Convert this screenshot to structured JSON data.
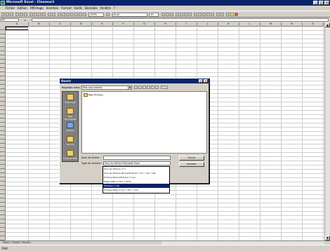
{
  "window": {
    "title": "Microsoft Excel - Classeur1",
    "controls": [
      "_",
      "□",
      "×"
    ]
  },
  "menu": [
    "Fichier",
    "Edition",
    "Affichage",
    "Insertion",
    "Format",
    "Outils",
    "Données",
    "Fenêtre",
    "?"
  ],
  "toolbar": {
    "zoom": "100%",
    "font": "Arial",
    "size": "10"
  },
  "formula_bar": {
    "name_box": "A1",
    "fx": "="
  },
  "columns": [
    "A",
    "B",
    "C",
    "D",
    "E",
    "F",
    "G",
    "H",
    "I",
    "J",
    "K",
    "L",
    "M",
    "N",
    "O"
  ],
  "sheet_tabs": "Feuil1 / Feuil2 / Feuil3 /",
  "status": "Prêt",
  "dialog": {
    "title": "Ouvrir",
    "look_in_label": "Regarder dans :",
    "look_in_value": "Mes documents",
    "places": [
      "Historique",
      "Mes documents",
      "Bureau",
      "Favoris",
      "Dossiers Web"
    ],
    "file_item": "Mes fichiers",
    "filename_label": "Nom de fichier :",
    "filetype_label": "Type de fichiers :",
    "filetype_value": "Tous les fichiers Microsoft Excel",
    "open_button": "Ouvrir",
    "cancel_button": "Annuler",
    "dropdown_options": [
      "Tous les fichiers (*.*)",
      "Tous les fichiers Microsoft Excel (*.xl*; *.xls; *.xlt)",
      "Fichiers Microsoft Excel (*.xls)",
      "Pages Web (*.htm; *.html)",
      "Modèles (*.xlt)",
      "Fichiers texte (*.prn; *.txt; *.csv)"
    ]
  }
}
